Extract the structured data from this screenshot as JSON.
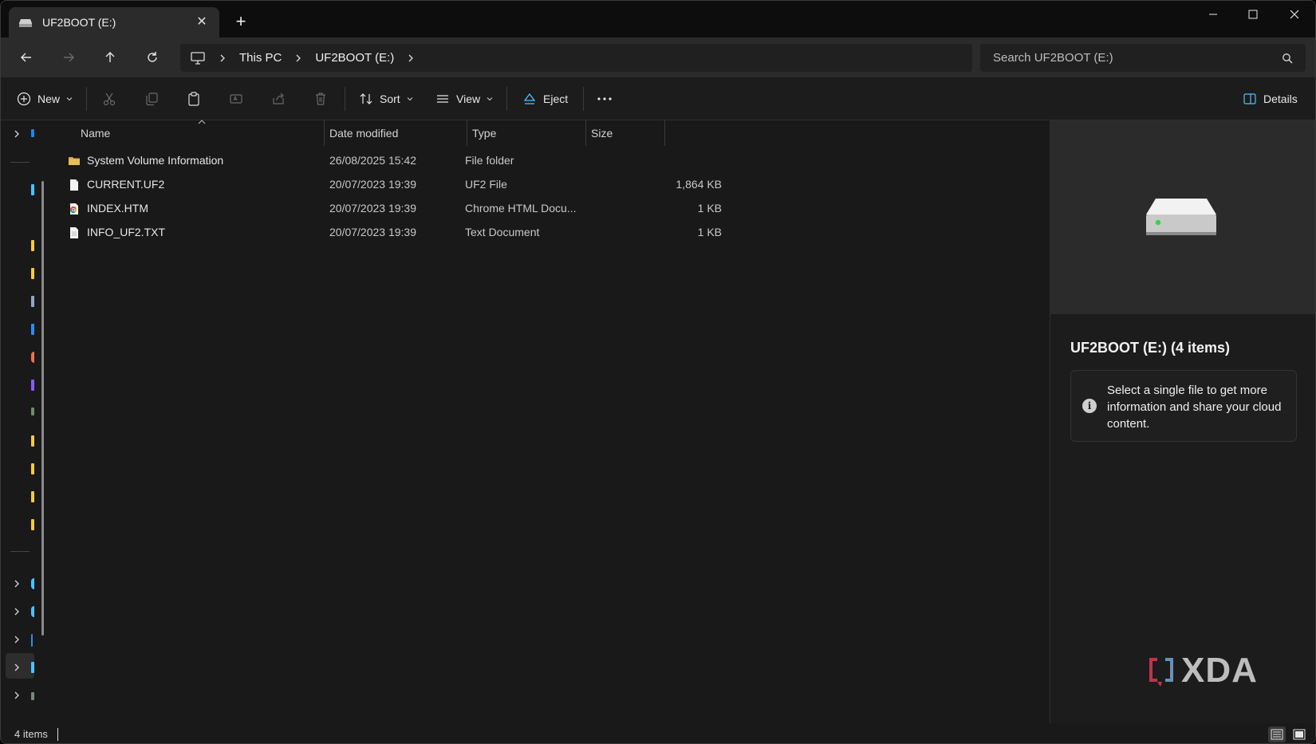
{
  "window": {
    "tab_title": "UF2BOOT (E:)",
    "new_tab_label": "+"
  },
  "address": {
    "crumbs": [
      "This PC",
      "UF2BOOT (E:)"
    ]
  },
  "search": {
    "placeholder": "Search UF2BOOT (E:)"
  },
  "toolbar": {
    "new_label": "New",
    "sort_label": "Sort",
    "view_label": "View",
    "eject_label": "Eject",
    "details_label": "Details"
  },
  "columns": {
    "name": "Name",
    "date": "Date modified",
    "type": "Type",
    "size": "Size"
  },
  "files": [
    {
      "name": "System Volume Information",
      "date": "26/08/2025 15:42",
      "type": "File folder",
      "size": "",
      "icon": "folder-icon"
    },
    {
      "name": "CURRENT.UF2",
      "date": "20/07/2023 19:39",
      "type": "UF2 File",
      "size": "1,864 KB",
      "icon": "file-icon"
    },
    {
      "name": "INDEX.HTM",
      "date": "20/07/2023 19:39",
      "type": "Chrome HTML Docu...",
      "size": "1 KB",
      "icon": "chrome-icon"
    },
    {
      "name": "INFO_UF2.TXT",
      "date": "20/07/2023 19:39",
      "type": "Text Document",
      "size": "1 KB",
      "icon": "text-file-icon"
    }
  ],
  "details_pane": {
    "title": "UF2BOOT (E:) (4 items)",
    "info": "Select a single file to get more information and share your cloud content."
  },
  "watermark": "XDA",
  "status": {
    "items": "4 items"
  },
  "colors": {
    "accent": "#4cc2ff",
    "folder": "#d9a948",
    "drive_led": "#2fd84a"
  }
}
